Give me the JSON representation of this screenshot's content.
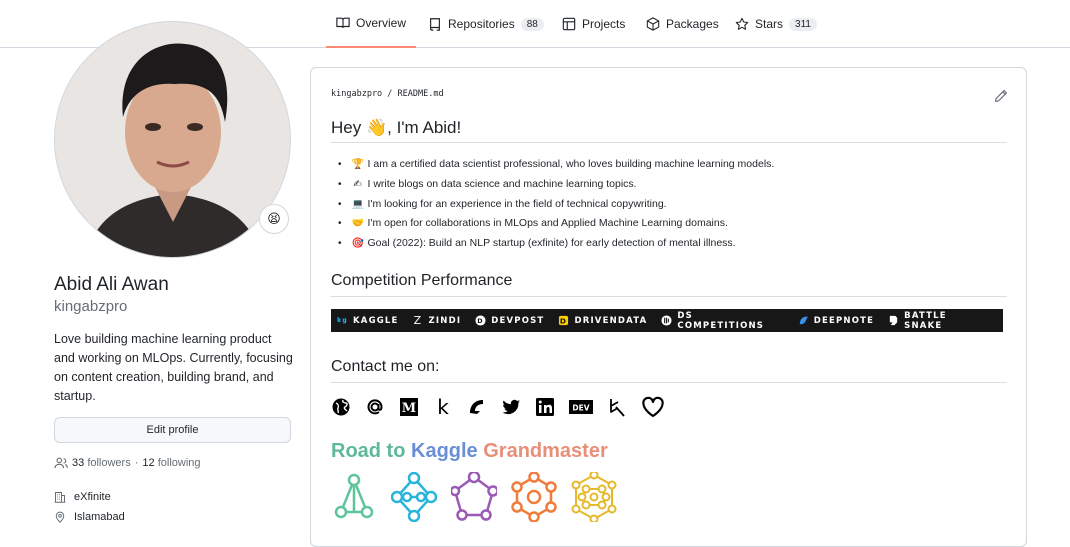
{
  "nav": {
    "tabs": [
      {
        "label": "Overview",
        "icon": "book-icon"
      },
      {
        "label": "Repositories",
        "icon": "repo-icon",
        "count": "88"
      },
      {
        "label": "Projects",
        "icon": "table-icon"
      },
      {
        "label": "Packages",
        "icon": "package-icon"
      },
      {
        "label": "Stars",
        "icon": "star-icon",
        "count": "311"
      }
    ]
  },
  "profile": {
    "status_emoji": "😫",
    "name": "Abid Ali Awan",
    "login": "kingabzpro",
    "bio": "Love building machine learning product and working on MLOps. Currently, focusing on content creation, building brand, and startup.",
    "edit_label": "Edit profile",
    "followers": "33",
    "followers_label": "followers",
    "sep": "·",
    "following": "12",
    "following_label": "following",
    "company": "eXfinite",
    "location": "Islamabad"
  },
  "readme": {
    "path": "kingabzpro / README.md",
    "heading": "Hey 👋, I'm Abid!",
    "bullets": [
      {
        "emoji": "🏆",
        "text": "I am a certified data scientist professional, who loves building machine learning models."
      },
      {
        "emoji": "✍",
        "text": "I write blogs on data science and machine learning topics."
      },
      {
        "emoji": "💻",
        "text": "I'm looking for an experience in the field of technical copywriting."
      },
      {
        "emoji": "🤝",
        "text": "I'm open for collaborations in MLOps and Applied Machine Learning domains."
      },
      {
        "emoji": "🎯",
        "text": "Goal (2022): Build an NLP startup (exfinite) for early detection of mental illness."
      }
    ],
    "competition_heading": "Competition Performance",
    "competitions": [
      "KAGGLE",
      "ZINDI",
      "DEVPOST",
      "DRIVENDATA",
      "DS COMPETITIONS",
      "DEEPNOTE",
      "BATTLE SNAKE"
    ],
    "contact_heading": "Contact me on:",
    "contact_icons": [
      "globe-icon",
      "at-icon",
      "medium-icon",
      "kaggle-icon",
      "codementor-icon",
      "twitter-icon",
      "linkedin-icon",
      "dev-icon",
      "datacamp-icon",
      "heart-icon"
    ],
    "dev_label": "DEV",
    "road_part1": "Road to ",
    "road_part2": "Kaggle ",
    "road_part3": "Grandmaster"
  }
}
